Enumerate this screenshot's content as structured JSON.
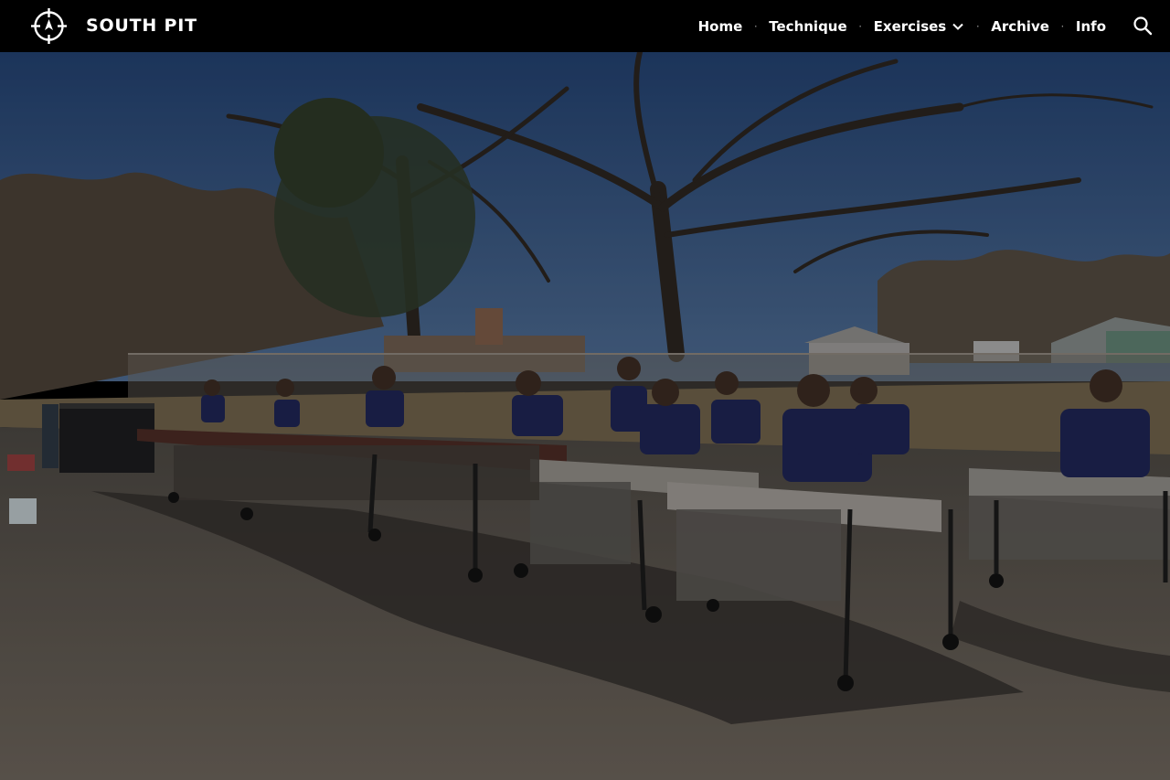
{
  "site": {
    "brand": "SOUTH PIT",
    "logo_icon": "compass-crosshair-icon"
  },
  "nav": {
    "items": [
      {
        "label": "Home",
        "active": true
      },
      {
        "label": "Technique"
      },
      {
        "label": "Exercises",
        "has_dropdown": true
      },
      {
        "label": "Archive"
      },
      {
        "label": "Info"
      }
    ],
    "separator": "·",
    "search_icon": "search-icon"
  },
  "hero": {
    "subject": "photo",
    "colors": {
      "sky": "#2b4a78",
      "pavement": "#5e5850",
      "shirt": "#1e2452",
      "header_bg": "#000000"
    }
  }
}
